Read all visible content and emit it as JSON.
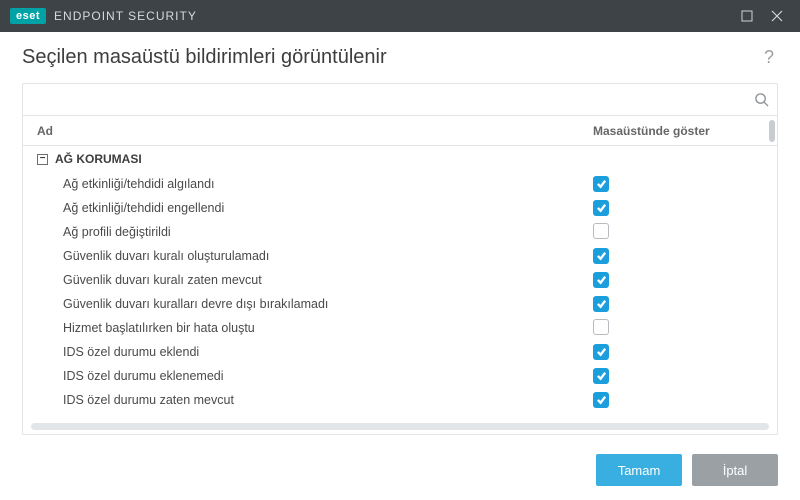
{
  "titlebar": {
    "brand_badge": "eset",
    "brand_text": "ENDPOINT SECURITY"
  },
  "header": {
    "title": "Seçilen masaüstü bildirimleri görüntülenir",
    "help": "?"
  },
  "search": {
    "value": "",
    "placeholder": ""
  },
  "columns": {
    "name": "Ad",
    "show": "Masaüstünde göster"
  },
  "group": {
    "label": "AĞ KORUMASI",
    "collapse_glyph": "−"
  },
  "rows": [
    {
      "label": "Ağ etkinliği/tehdidi algılandı",
      "checked": true
    },
    {
      "label": "Ağ etkinliği/tehdidi engellendi",
      "checked": true
    },
    {
      "label": "Ağ profili değiştirildi",
      "checked": false
    },
    {
      "label": "Güvenlik duvarı kuralı oluşturulamadı",
      "checked": true
    },
    {
      "label": "Güvenlik duvarı kuralı zaten mevcut",
      "checked": true
    },
    {
      "label": "Güvenlik duvarı kuralları devre dışı bırakılamadı",
      "checked": true
    },
    {
      "label": "Hizmet başlatılırken bir hata oluştu",
      "checked": false
    },
    {
      "label": "IDS özel durumu eklendi",
      "checked": true
    },
    {
      "label": "IDS özel durumu eklenemedi",
      "checked": true
    },
    {
      "label": "IDS özel durumu zaten mevcut",
      "checked": true
    }
  ],
  "footer": {
    "ok": "Tamam",
    "cancel": "İptal"
  }
}
